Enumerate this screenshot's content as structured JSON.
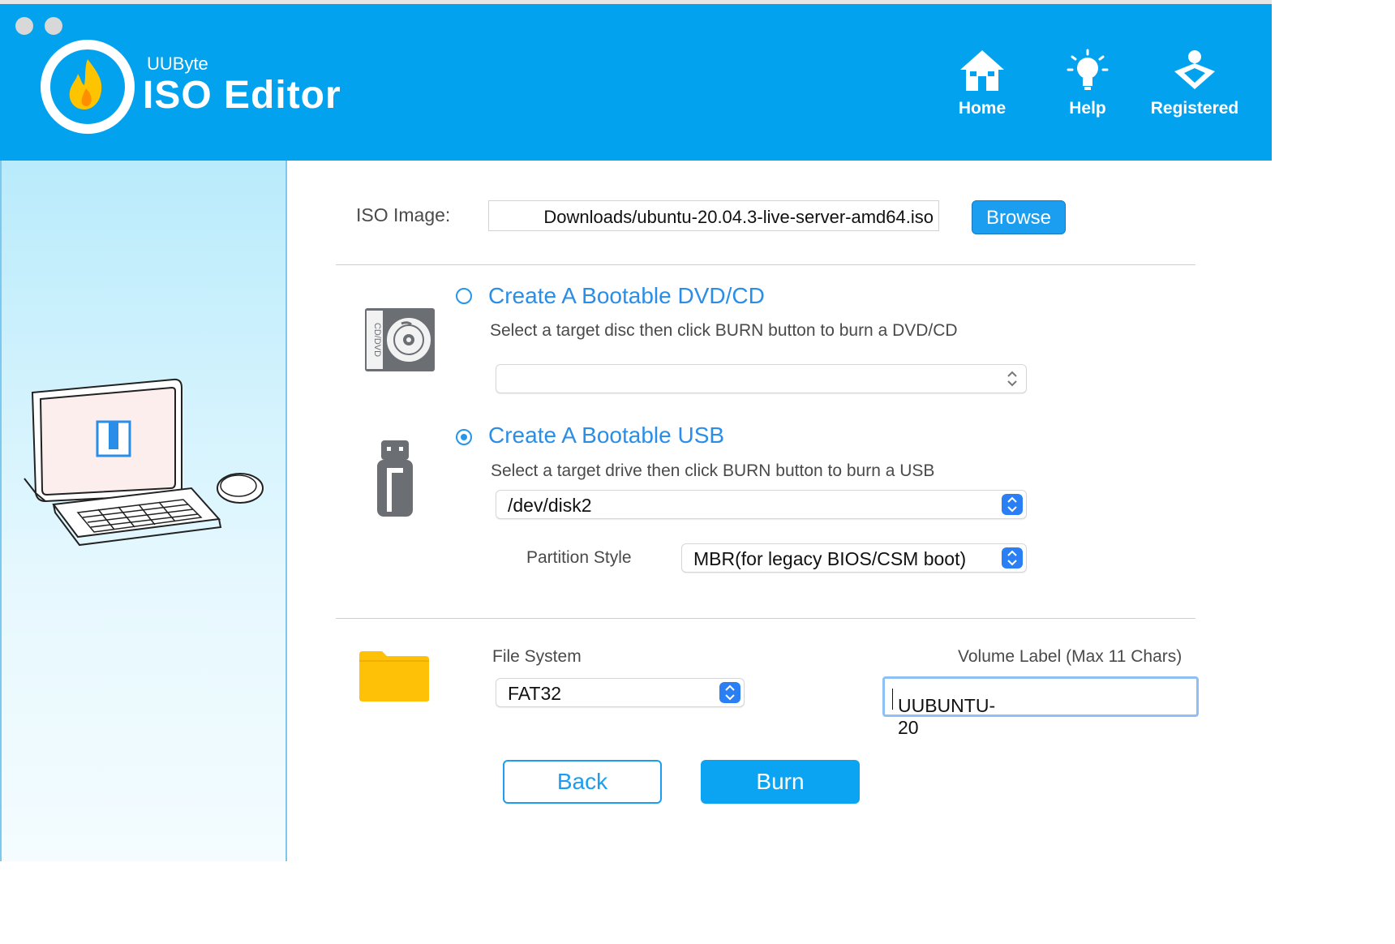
{
  "app": {
    "brand_small": "UUByte",
    "brand_name": "ISO Editor"
  },
  "nav": [
    {
      "label": "Home",
      "icon": "home-icon"
    },
    {
      "label": "Help",
      "icon": "lightbulb-icon"
    },
    {
      "label": "Registered",
      "icon": "registered-user-icon"
    }
  ],
  "iso": {
    "label": "ISO Image:",
    "path": "Downloads/ubuntu-20.04.3-live-server-amd64.iso",
    "browse_label": "Browse"
  },
  "dvd": {
    "title": "Create A Bootable DVD/CD",
    "description": "Select a target disc then click BURN button to burn a DVD/CD",
    "selected_disc": "",
    "selected": false,
    "icon_text": "CD/DVD"
  },
  "usb": {
    "title": "Create A Bootable USB",
    "description": "Select a target drive then click BURN button to burn a USB",
    "selected_drive": "/dev/disk2",
    "selected": true
  },
  "partition": {
    "label": "Partition Style",
    "value": "MBR(for legacy BIOS/CSM boot)"
  },
  "filesystem": {
    "label": "File System",
    "value": "FAT32"
  },
  "volume": {
    "label": "Volume Label (Max 11 Chars)",
    "value": "UUBUNTU-20"
  },
  "actions": {
    "back_label": "Back",
    "burn_label": "Burn"
  },
  "colors": {
    "topbar": "#03a2ef",
    "accent": "#2a8ee8",
    "burn_button": "#0ba4f2",
    "folder": "#ffc107"
  }
}
